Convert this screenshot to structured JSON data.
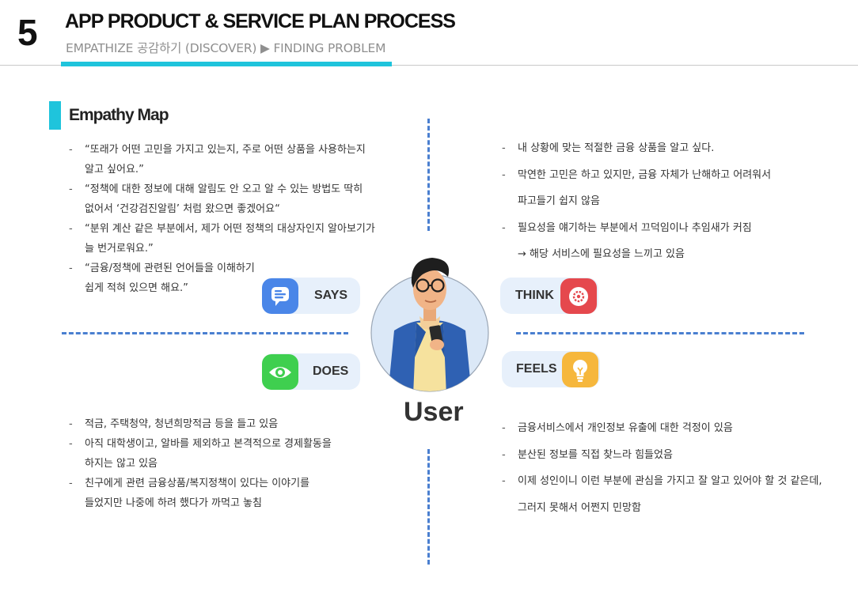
{
  "header": {
    "page_number": "5",
    "title": "APP PRODUCT & SERVICE PLAN PROCESS",
    "subtitle": "EMPATHIZE 공감하기 (DISCOVER) ▶ FINDING PROBLEM"
  },
  "section": {
    "title": "Empathy Map"
  },
  "quadrants": {
    "says": {
      "label": "SAYS",
      "icon": "speech-bubble-icon",
      "color": "#4a86e8",
      "lines": [
        "“또래가 어떤 고민을 가지고 있는지, 주로 어떤 상품을 사용하는지",
        "알고 싶어요.”",
        "“정책에 대한 정보에 대해 알림도 안 오고 알 수 있는 방법도 딱히",
        "없어서 ‘건강검진알림’ 처럼 왔으면 좋겠어요“",
        "“분위 계산 같은 부분에서, 제가 어떤 정책의 대상자인지 알아보기가",
        "늘 번거로워요.”",
        "“금융/정책에 관련된 언어들을 이해하기",
        "쉽게 적혀 있으면 해요.”"
      ]
    },
    "think": {
      "label": "THINK",
      "icon": "brain-gear-icon",
      "color": "#e5484d",
      "lines": [
        "내 상황에 맞는 적절한 금융 상품을 알고 싶다.",
        "막연한 고민은 하고 있지만, 금융 자체가 난해하고 어려워서",
        "파고들기 쉽지 않음",
        "필요성을 얘기하는 부분에서 끄덕임이나 추임새가 커짐",
        "→ 해당 서비스에 필요성을 느끼고 있음"
      ]
    },
    "does": {
      "label": "DOES",
      "icon": "eye-icon",
      "color": "#3fcf4f",
      "lines": [
        "적금, 주택청약, 청년희망적금 등을 들고 있음",
        "아직 대학생이고, 알바를 제외하고 본격적으로 경제활동을",
        "하지는 않고 있음",
        "친구에게 관련 금융상품/복지정책이 있다는 이야기를",
        "들었지만 나중에 하려 했다가 까먹고 놓침"
      ]
    },
    "feels": {
      "label": "FEELS",
      "icon": "lightbulb-icon",
      "color": "#f6b73c",
      "lines": [
        "금융서비스에서 개인정보 유출에 대한 걱정이 있음",
        "분산된 정보를 직접 찾느라 힘들었음",
        "이제 성인이니 이런 부분에 관심을 가지고 잘 알고 있어야 할 것 같은데,",
        "그러지 못해서 어쩐지 민망함"
      ]
    }
  },
  "center": {
    "label": "User",
    "avatar": "user-avatar-illustration"
  }
}
